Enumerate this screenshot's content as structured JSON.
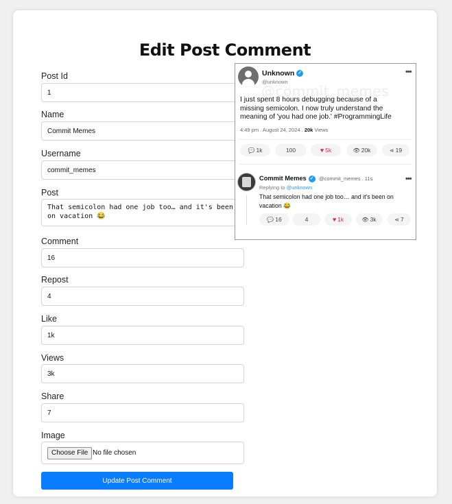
{
  "page": {
    "title": "Edit Post Comment"
  },
  "form": {
    "post_id": {
      "label": "Post Id",
      "value": "1"
    },
    "name": {
      "label": "Name",
      "value": "Commit Memes"
    },
    "username": {
      "label": "Username",
      "value": "commit_memes"
    },
    "post": {
      "label": "Post",
      "value": "That semicolon had one job too… and it's been on vacation 😂"
    },
    "comment": {
      "label": "Comment",
      "value": "16"
    },
    "repost": {
      "label": "Repost",
      "value": "4"
    },
    "like": {
      "label": "Like",
      "value": "1k"
    },
    "views": {
      "label": "Views",
      "value": "3k"
    },
    "share": {
      "label": "Share",
      "value": "7"
    },
    "image": {
      "label": "Image",
      "button_label": "Choose File",
      "status": "No file chosen"
    },
    "submit_label": "Update Post Comment"
  },
  "preview": {
    "original": {
      "name": "Unknown",
      "handle": "@unknown",
      "watermark": "@commit_memes",
      "text": "I just spent 8 hours debugging because of a missing semicolon. I now truly understand the meaning of 'you had one job.' #ProgrammingLife",
      "meta_prefix": "4:49 pm . August 24, 2024 . ",
      "meta_views": "20k",
      "meta_suffix": " Views",
      "stats": {
        "comments": "1k",
        "reposts": "100",
        "likes": "5k",
        "views": "20k",
        "shares": "19"
      }
    },
    "reply": {
      "name": "Commit Memes",
      "handle_time": "@commit_memes . 11s",
      "replying_prefix": "Replying to ",
      "replying_to": "@unknown",
      "text": "That semicolon had one job too… and it's been on vacation 😂",
      "stats": {
        "comments": "16",
        "reposts": "4",
        "likes": "1k",
        "views": "3k",
        "shares": "7"
      }
    }
  },
  "colors": {
    "primary_button": "#0a7cff",
    "verified_badge": "#1d9bf0",
    "like_pink": "#e0245e"
  },
  "icons": [
    "verified-icon",
    "more-icon",
    "comment-icon",
    "heart-icon",
    "eye-icon",
    "share-icon",
    "avatar-icon"
  ]
}
